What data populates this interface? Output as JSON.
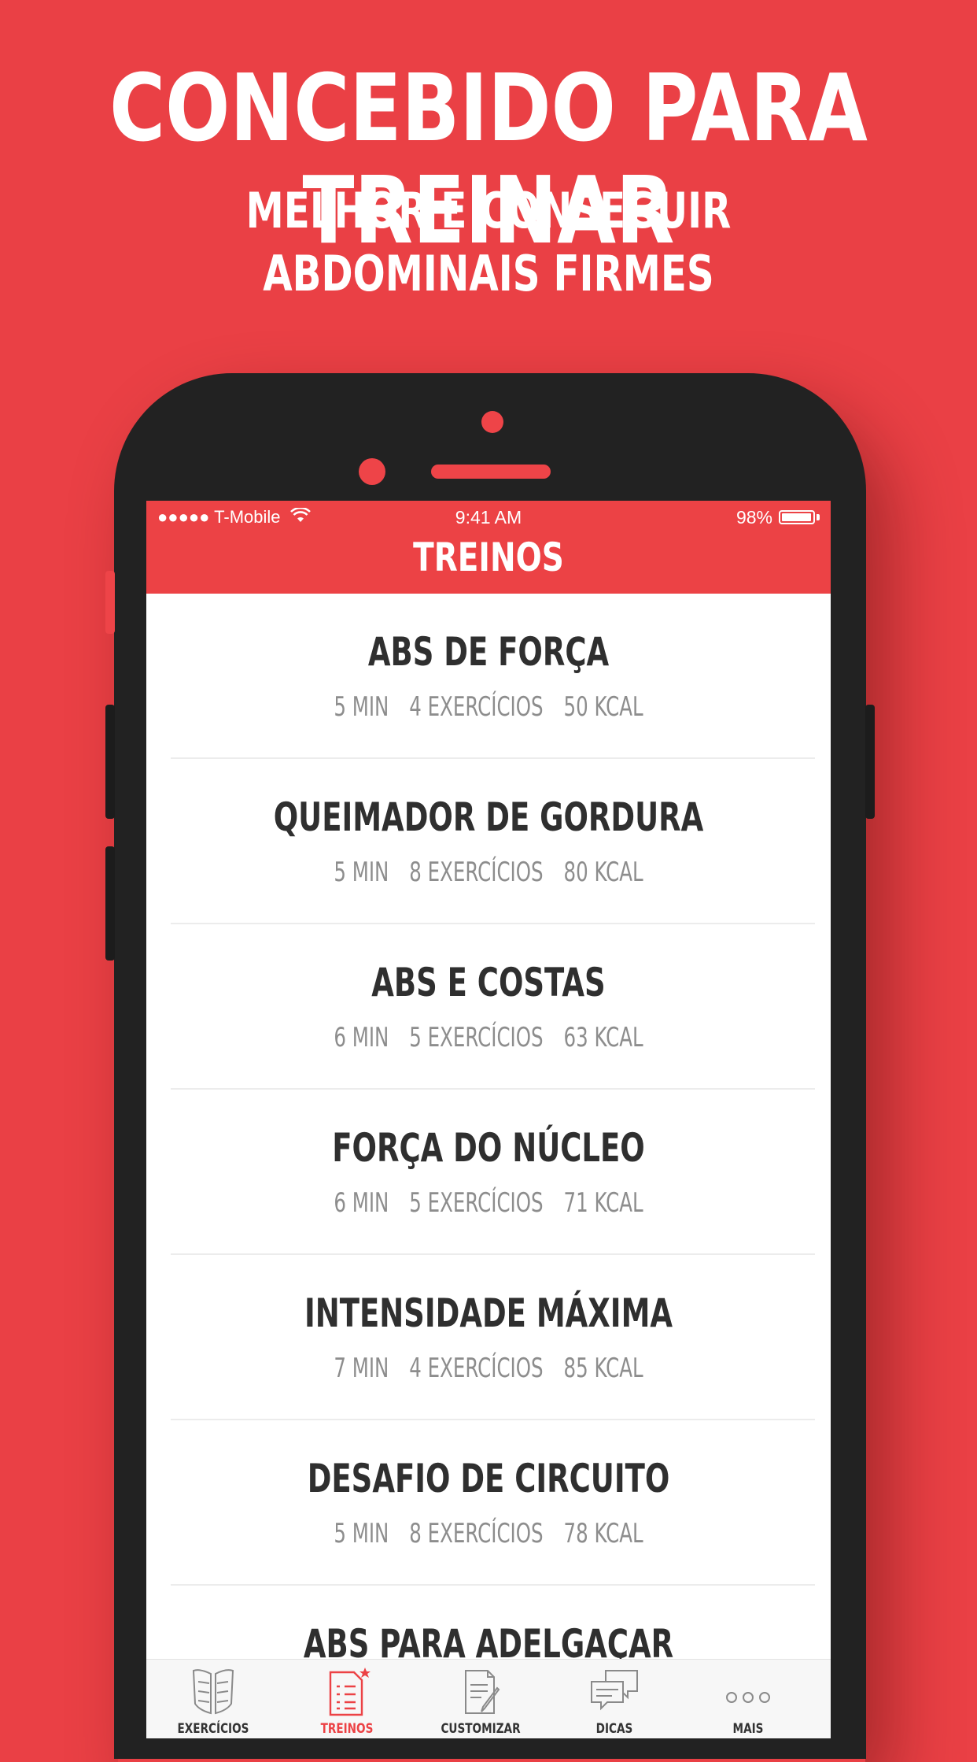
{
  "banner": {
    "headline": "CONCEBIDO PARA TREINAR",
    "subheadline": "MELHOR E CONSEGUIR ABDOMINAIS FIRMES"
  },
  "status_bar": {
    "carrier": "●●●●● T-Mobile",
    "time": "9:41 AM",
    "battery": "98%",
    "battery_level": 0.98
  },
  "nav": {
    "title": "TREINOS"
  },
  "workouts": [
    {
      "title": "ABS DE FORÇA",
      "duration": "5 MIN",
      "exercises": "4 EXERCÍCIOS",
      "calories": "50 KCAL"
    },
    {
      "title": "QUEIMADOR DE GORDURA",
      "duration": "5 MIN",
      "exercises": "8 EXERCÍCIOS",
      "calories": "80 KCAL"
    },
    {
      "title": "ABS E COSTAS",
      "duration": "6 MIN",
      "exercises": "5 EXERCÍCIOS",
      "calories": "63 KCAL"
    },
    {
      "title": "FORÇA DO NÚCLEO",
      "duration": "6 MIN",
      "exercises": "5 EXERCÍCIOS",
      "calories": "71 KCAL"
    },
    {
      "title": "INTENSIDADE MÁXIMA",
      "duration": "7 MIN",
      "exercises": "4 EXERCÍCIOS",
      "calories": "85 KCAL"
    },
    {
      "title": "DESAFIO DE CIRCUITO",
      "duration": "5 MIN",
      "exercises": "8 EXERCÍCIOS",
      "calories": "78 KCAL"
    },
    {
      "title": "ABS PARA ADELGAÇAR",
      "duration": "",
      "exercises": "",
      "calories": ""
    }
  ],
  "tabs": [
    {
      "label": "EXERCÍCIOS",
      "icon": "abs-icon",
      "active": false
    },
    {
      "label": "TREINOS",
      "icon": "checklist-icon",
      "active": true
    },
    {
      "label": "CUSTOMIZAR",
      "icon": "document-edit-icon",
      "active": false
    },
    {
      "label": "DICAS",
      "icon": "chat-bubbles-icon",
      "active": false
    },
    {
      "label": "MAIS",
      "icon": "more-dots-icon",
      "active": false
    }
  ],
  "colors": {
    "background": "#ea4045",
    "accent": "#ec4245",
    "phone_body": "#222222",
    "title_text": "#2f2f2f",
    "meta_text": "#8d8d8d"
  }
}
